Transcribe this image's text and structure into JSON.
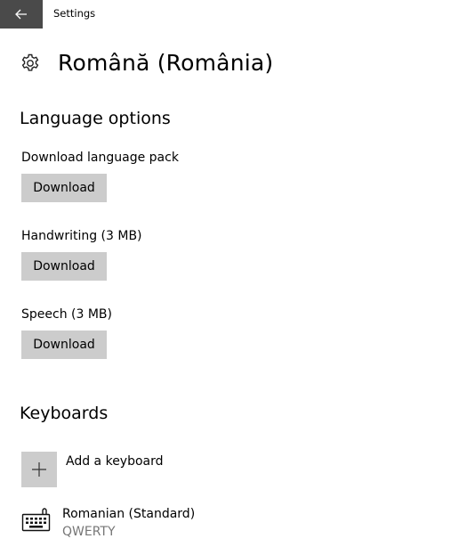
{
  "window": {
    "title": "Settings"
  },
  "page": {
    "title": "Română (România)"
  },
  "language_options": {
    "heading": "Language options",
    "items": [
      {
        "label": "Download language pack",
        "button": "Download"
      },
      {
        "label": "Handwriting (3 MB)",
        "button": "Download"
      },
      {
        "label": "Speech (3 MB)",
        "button": "Download"
      }
    ]
  },
  "keyboards": {
    "heading": "Keyboards",
    "add_label": "Add a keyboard",
    "list": [
      {
        "name": "Romanian (Standard)",
        "layout": "QWERTY"
      }
    ]
  },
  "icons": {
    "back": "back-arrow-icon",
    "settings": "gear-icon",
    "add": "plus-icon",
    "keyboard": "keyboard-icon"
  },
  "colors": {
    "back_button_bg": "#4a4a4a",
    "button_bg": "#cccccc",
    "secondary_text": "#767676"
  }
}
